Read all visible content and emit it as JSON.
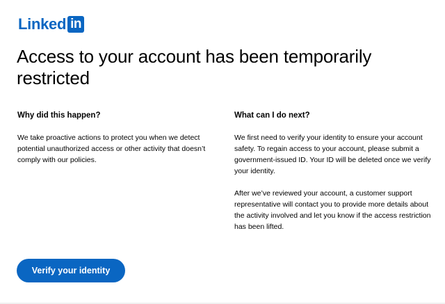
{
  "brand": {
    "word": "Linked",
    "box": "in",
    "color": "#0a66c2"
  },
  "title": "Access to your account has been temporarily restricted",
  "why": {
    "heading": "Why did this happen?",
    "body": "We take proactive actions to protect you when we detect potential unauthorized access or other activity that doesn’t comply with our policies."
  },
  "next": {
    "heading": "What can I do next?",
    "body1": "We first need to verify your identity to ensure your account safety. To regain access to your account, please submit a government-issued ID. Your ID will be deleted once we verify your identity.",
    "body2": "After we’ve reviewed your account, a customer support representative will contact you to provide more details about the activity involved and let you know if the access restriction has been lifted."
  },
  "actions": {
    "verify_label": "Verify your identity"
  }
}
